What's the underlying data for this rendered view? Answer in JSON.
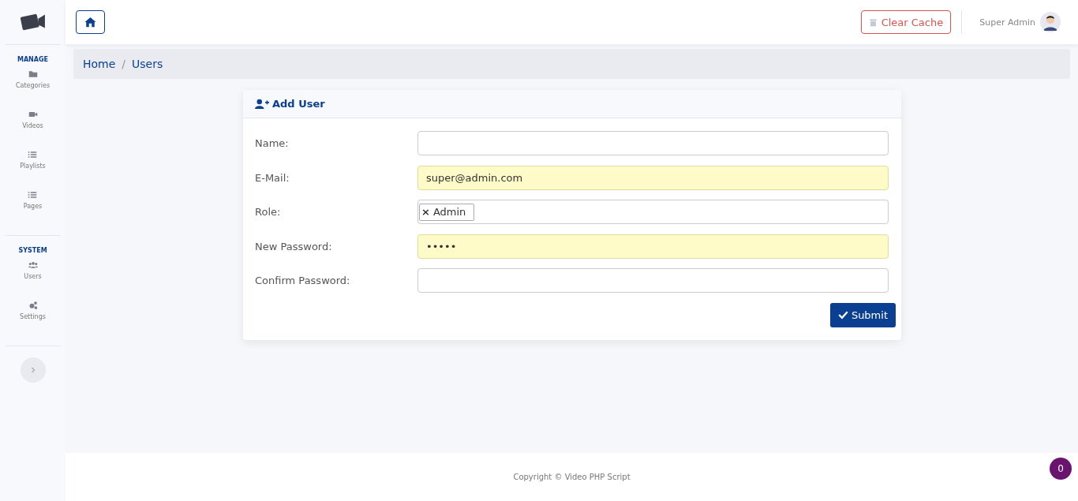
{
  "sidebar": {
    "sections": [
      {
        "title": "MANAGE",
        "items": [
          {
            "label": "Categories"
          },
          {
            "label": "Videos"
          },
          {
            "label": "Playlists"
          },
          {
            "label": "Pages"
          }
        ]
      },
      {
        "title": "SYSTEM",
        "items": [
          {
            "label": "Users"
          },
          {
            "label": "Settings"
          }
        ]
      }
    ]
  },
  "header": {
    "clear_cache": "Clear Cache",
    "user_name": "Super Admin"
  },
  "breadcrumb": {
    "separator": "/",
    "items": [
      {
        "label": "Home"
      },
      {
        "label": "Users"
      }
    ]
  },
  "card": {
    "title": "Add User",
    "fields": [
      {
        "kind": "text",
        "label": "Name:",
        "autofilled": false
      },
      {
        "kind": "text",
        "label": "E-Mail:",
        "value": "super@admin.com",
        "autofilled": true
      },
      {
        "kind": "tags",
        "label": "Role:",
        "tags": [
          {
            "remove": "×",
            "label": "Admin"
          }
        ],
        "autofilled": false
      },
      {
        "kind": "text",
        "label": "New Password:",
        "value": "•••••",
        "autofilled": true
      },
      {
        "kind": "text",
        "label": "Confirm Password:",
        "autofilled": false
      }
    ],
    "submit": "Submit"
  },
  "footer": {
    "copyright": "Copyright © Video PHP Script",
    "badge": "0"
  }
}
